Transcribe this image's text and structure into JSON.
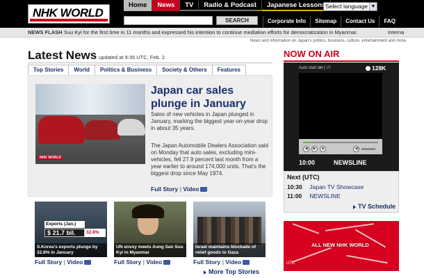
{
  "header": {
    "logo": "NHK WORLD",
    "tabs": [
      "Home",
      "News",
      "TV",
      "Radio & Podcast",
      "Japanese Lessons"
    ],
    "language_select": "Select language",
    "search_button": "SEARCH",
    "utility_links": [
      "Corporate Info",
      "Sitemap",
      "Contact Us",
      "FAQ"
    ]
  },
  "news_flash": {
    "label": "NEWS FLASH",
    "text": "Suu Kyi for the first time in 11 months and expressed his intention to continue mediation efforts for democratization in Myanmar.",
    "text_next": "Interna"
  },
  "subline": "News and information on Japan's politics, business, culture, entertainment and more.",
  "latest": {
    "title": "Latest News",
    "updated": "updated at 9:35 UTC, Feb. 2",
    "categories": [
      "Top Stories",
      "World",
      "Politics & Business",
      "Society & Others",
      "Features"
    ],
    "feature": {
      "image_caption": "NHK WORLD",
      "title": "Japan car sales plunge in January",
      "summary": "Sales of new vehicles in Japan plunged in January, marking the biggest year-on-year drop in about 35 years.",
      "body": "The Japan Automobile Dealers Association said on Monday that auto sales, excluding mini-vehicles, fell 27.9 percent last month from a year earlier to around 174,000 units. That's the biggest drop since May 1974.",
      "full_story": "Full Story",
      "video": "Video"
    },
    "thumbs": [
      {
        "caption": "S.Korea's exports plunge by 32.8% in January",
        "overlay_label": "Exports (Jan.)",
        "overlay_value": "$ 21.7 bil.",
        "overlay_change": "32.8%",
        "full_story": "Full Story",
        "video": "Video"
      },
      {
        "caption": "UN envoy meets Aung San Suu Kyi in Myanmar",
        "full_story": "Full Story",
        "video": "Video"
      },
      {
        "caption": "Israel maintains blockade of relief goods to Gaza",
        "full_story": "Full Story",
        "video": "Video"
      }
    ],
    "more": "More Top Stories"
  },
  "now_on_air": {
    "title": "NOW ON AIR",
    "autostart": "Auto start",
    "autostart_on": "on",
    "autostart_off": "off",
    "bitrate": "128K",
    "progress": 0.1,
    "time": "10:00",
    "program": "NEWSLINE",
    "next_title": "Next (UTC)",
    "next": [
      {
        "time": "10:30",
        "program": "Japan TV Showcase"
      },
      {
        "time": "11:00",
        "program": "NEWSLINE"
      }
    ],
    "schedule_link": "TV Schedule"
  },
  "promo": {
    "text": "ALL NEW NHK WORLD",
    "small": "UTC"
  },
  "colors": {
    "accent_red": "#c8001e",
    "link_blue": "#1a2f6e"
  }
}
